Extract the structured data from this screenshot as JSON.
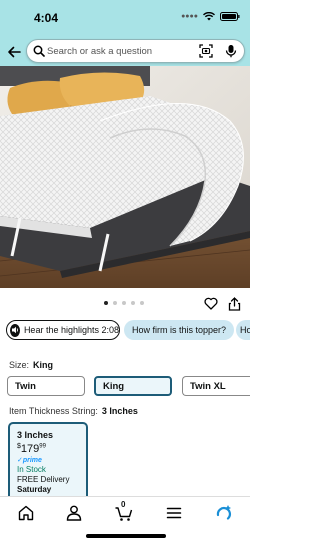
{
  "status": {
    "time": "4:04",
    "icons": [
      "signal-icon",
      "wifi-icon",
      "battery-icon"
    ]
  },
  "search": {
    "placeholder": "Search or ask a question"
  },
  "carousel": {
    "count": 5,
    "active_index": 0
  },
  "chips": {
    "highlights": "Hear the highlights 2:08",
    "question1": "How firm is this topper?",
    "question2": "Ho"
  },
  "size": {
    "label": "Size:",
    "selected": "King",
    "options": [
      "Twin",
      "King",
      "Twin XL"
    ]
  },
  "thickness": {
    "label": "Item Thickness String:",
    "selected": "3 Inches",
    "card": {
      "title": "3 Inches",
      "currency": "$",
      "price_whole": "179",
      "price_fraction": "99",
      "prime": "✓prime",
      "stock": "In Stock",
      "delivery": "FREE Delivery",
      "day": "Saturday"
    }
  },
  "nav": {
    "cart_count": "0"
  },
  "colors": {
    "header": "#a8e3e6",
    "selected_border": "#1d5c78",
    "in_stock": "#067d62",
    "prime": "#1a98ff"
  }
}
